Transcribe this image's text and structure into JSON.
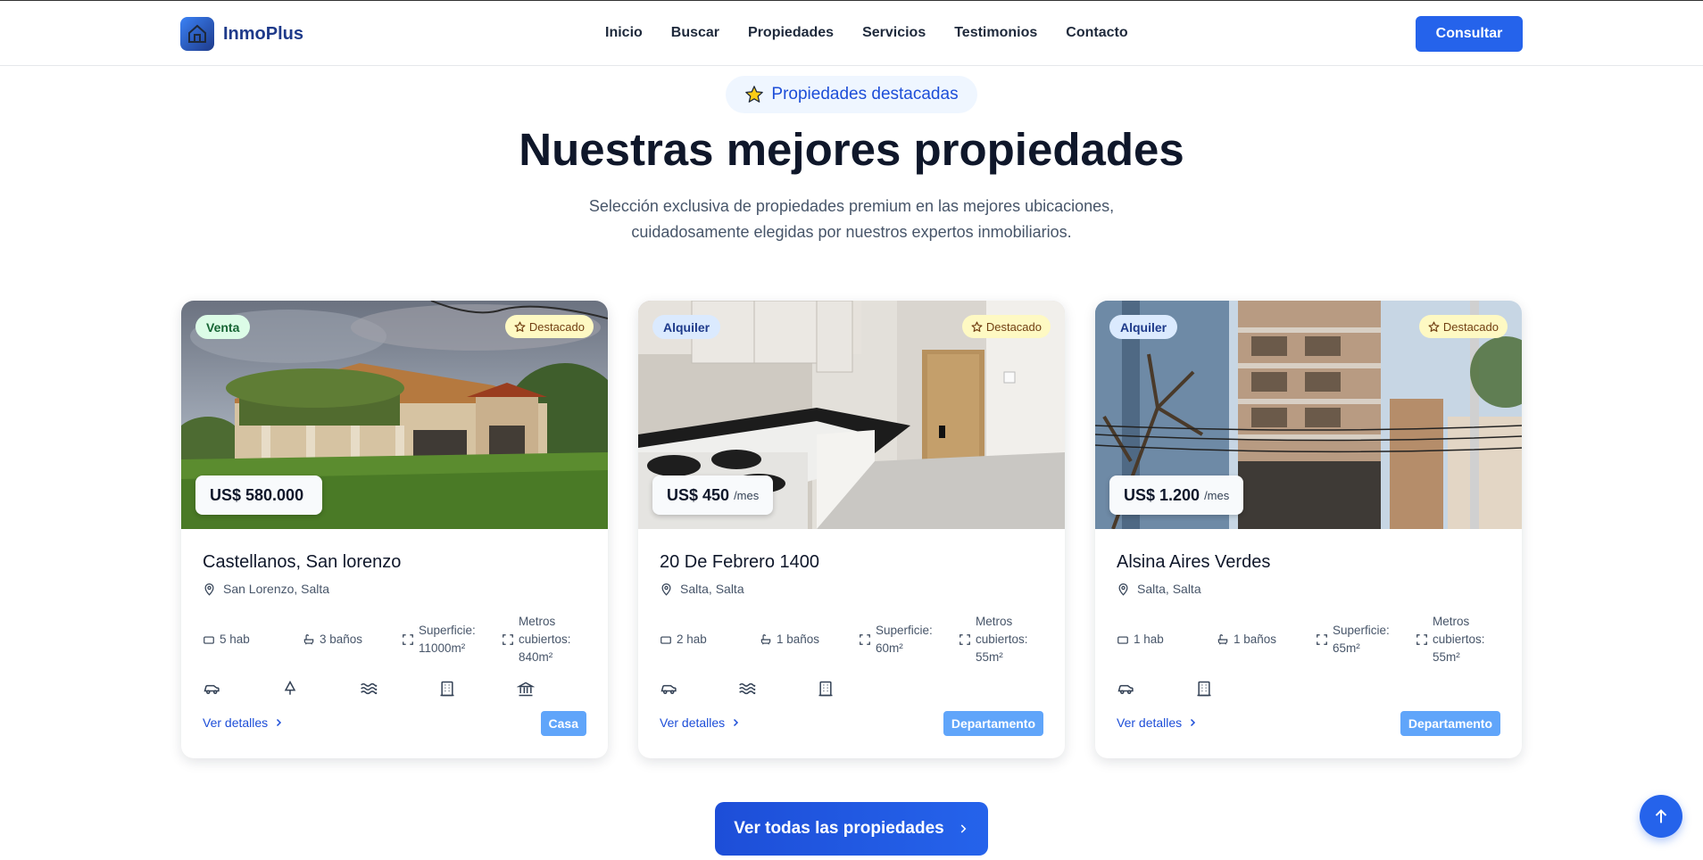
{
  "nav": {
    "brand": "InmoPlus",
    "links": [
      "Inicio",
      "Buscar",
      "Propiedades",
      "Servicios",
      "Testimonios",
      "Contacto"
    ],
    "cta": "Consultar"
  },
  "section": {
    "pill": "Propiedades destacadas",
    "title": "Nuestras mejores propiedades",
    "subtitle_line1": "Selección exclusiva de propiedades premium en las mejores ubicaciones,",
    "subtitle_line2": "cuidadosamente elegidas por nuestros expertos inmobiliarios."
  },
  "featured_label": "Destacado",
  "details_label": "Ver detalles",
  "cards": [
    {
      "operation": "Venta",
      "price": "US$ 580.000",
      "price_suffix": "",
      "title": "Castellanos, San lorenzo",
      "location": "San Lorenzo, Salta",
      "rooms": "5 hab",
      "baths": "3 baños",
      "area": [
        "Superficie:",
        "11000m²"
      ],
      "covered": [
        "Metros",
        "cubiertos:",
        "840m²"
      ],
      "amenities": [
        "car-icon",
        "tree-icon",
        "waves-icon",
        "building-icon",
        "landmark-icon"
      ],
      "type": "Casa"
    },
    {
      "operation": "Alquiler",
      "price": "US$ 450",
      "price_suffix": "/mes",
      "title": "20 De Febrero 1400",
      "location": "Salta, Salta",
      "rooms": "2 hab",
      "baths": "1 baños",
      "area": [
        "Superficie:",
        "60m²"
      ],
      "covered": [
        "Metros",
        "cubiertos:",
        "55m²"
      ],
      "amenities": [
        "car-icon",
        "waves-icon",
        "building-icon"
      ],
      "type": "Departamento"
    },
    {
      "operation": "Alquiler",
      "price": "US$ 1.200",
      "price_suffix": "/mes",
      "title": "Alsina Aires Verdes",
      "location": "Salta, Salta",
      "rooms": "1 hab",
      "baths": "1 baños",
      "area": [
        "Superficie:",
        "65m²"
      ],
      "covered": [
        "Metros",
        "cubiertos:",
        "55m²"
      ],
      "amenities": [
        "car-icon",
        "building-icon"
      ],
      "type": "Departamento"
    }
  ],
  "view_all": "Ver todas las propiedades",
  "colors": {
    "primary": "#2563eb",
    "brand_dark": "#1e3a8a",
    "type_badge": "#60a5fa",
    "featured_bg": "#fef9c3",
    "sale_bg": "#dcfce7",
    "rent_bg": "#dbeafe"
  }
}
